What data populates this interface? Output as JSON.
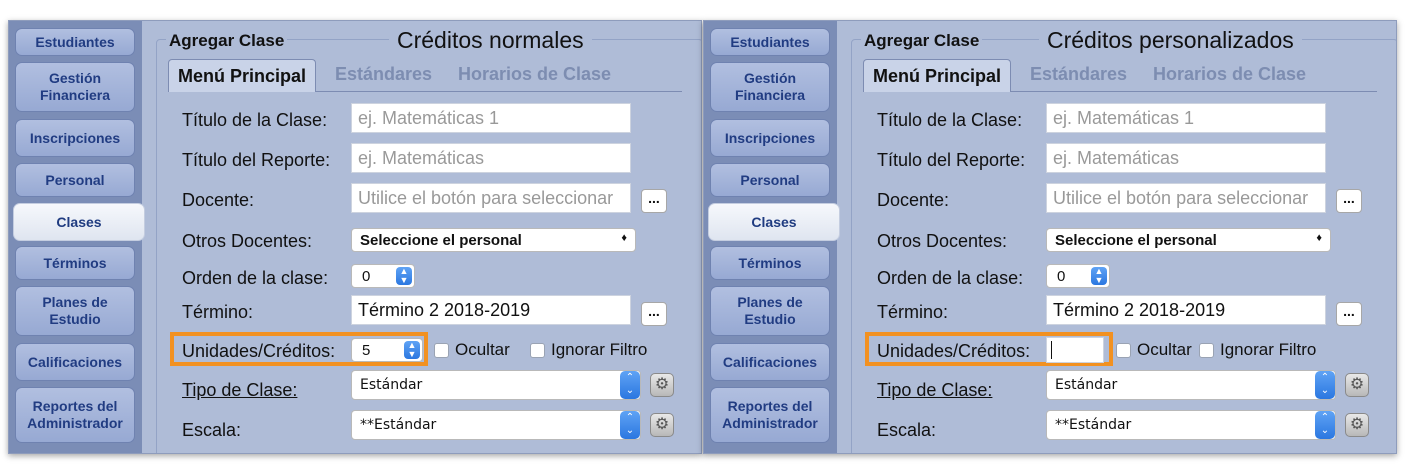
{
  "sidebar": {
    "items": [
      {
        "label": "Estudiantes"
      },
      {
        "label": "Gestión Financiera"
      },
      {
        "label": "Inscripciones"
      },
      {
        "label": "Personal"
      },
      {
        "label": "Clases"
      },
      {
        "label": "Términos"
      },
      {
        "label": "Planes de Estudio"
      },
      {
        "label": "Calificaciones"
      },
      {
        "label": "Reportes del Administrador"
      }
    ],
    "active": "Clases"
  },
  "panels": [
    {
      "heading": "Créditos normales",
      "units_value": "5",
      "units_type": "stepper"
    },
    {
      "heading": "Créditos personalizados",
      "units_value": "",
      "units_type": "text"
    }
  ],
  "form": {
    "group_label": "Agregar Clase",
    "tabs": [
      {
        "label": "Menú Principal",
        "active": true
      },
      {
        "label": "Estándares",
        "active": false
      },
      {
        "label": "Horarios de Clase",
        "active": false
      }
    ],
    "title_label": "Título de la Clase:",
    "title_placeholder": "ej. Matemáticas 1",
    "report_title_label": "Título del Reporte:",
    "report_title_placeholder": "ej. Matemáticas",
    "teacher_label": "Docente:",
    "teacher_placeholder": "Utilice el botón para seleccionar",
    "other_teachers_label": "Otros Docentes:",
    "other_teachers_value": "Seleccione el personal",
    "order_label": "Orden de la clase:",
    "order_value": "0",
    "term_label": "Término:",
    "term_value": "Término 2 2018-2019",
    "units_label": "Unidades/Créditos:",
    "hide_label": "Ocultar",
    "ignore_filter_label": "Ignorar Filtro",
    "class_type_label": "Tipo de Clase:",
    "class_type_value": "Estándar",
    "scale_label": "Escala:",
    "scale_value": "**Estándar",
    "ellipsis": "...",
    "highlight_color": "#f29121"
  }
}
